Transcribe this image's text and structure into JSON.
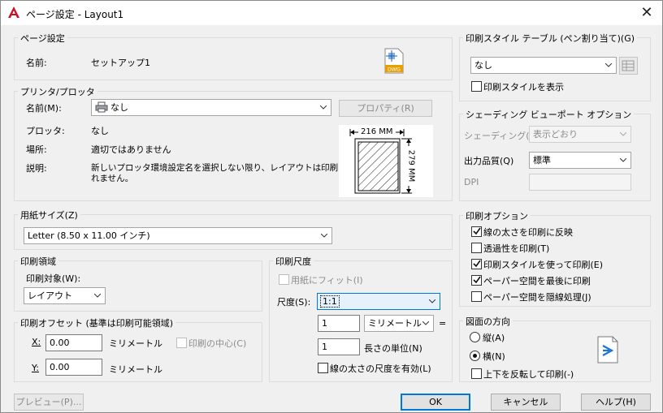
{
  "window": {
    "title": "ページ設定 - Layout1"
  },
  "page_setup": {
    "legend": "ページ設定",
    "name_label": "名前:",
    "name_value": "セットアップ1"
  },
  "printer": {
    "legend": "プリンタ/プロッタ",
    "name_label": "名前(M):",
    "name_value": "なし",
    "properties_button": "プロパティ(R)",
    "plotter_label": "プロッタ:",
    "plotter_value": "なし",
    "location_label": "場所:",
    "location_value": "適切ではありません",
    "description_label": "説明:",
    "description_line1": "新しいプロッタ環境設定名を選択しない限り、レイアウトは印刷さ",
    "description_line2": "れません。",
    "preview_width": "216 MM",
    "preview_height": "279 MM"
  },
  "paper_size": {
    "legend": "用紙サイズ(Z)",
    "value": "Letter (8.50 x 11.00 インチ)"
  },
  "plot_area": {
    "legend": "印刷領域",
    "what_label": "印刷対象(W):",
    "what_value": "レイアウト"
  },
  "plot_offset": {
    "legend": "印刷オフセット (基準は印刷可能領域)",
    "x_label": "X:",
    "x_value": "0.00",
    "x_unit": "ミリメートル",
    "y_label": "Y:",
    "y_value": "0.00",
    "y_unit": "ミリメートル",
    "center_label": "印刷の中心(C)"
  },
  "plot_scale": {
    "legend": "印刷尺度",
    "fit_label": "用紙にフィット(I)",
    "scale_label": "尺度(S):",
    "scale_value": "1:1",
    "value1": "1",
    "unit_value": "ミリメートル",
    "equals": "=",
    "value2": "1",
    "unit_label": "長さの単位(N)",
    "lineweights_label": "線の太さの尺度を有効(L)"
  },
  "plot_style_table": {
    "legend": "印刷スタイル テーブル (ペン割り当て)(G)",
    "value": "なし",
    "display_label": "印刷スタイルを表示"
  },
  "shaded_viewport": {
    "legend": "シェーディング ビューポート オプション",
    "shade_label": "シェーディング(D)",
    "shade_value": "表示どおり",
    "quality_label": "出力品質(Q)",
    "quality_value": "標準",
    "dpi_label": "DPI"
  },
  "plot_options": {
    "legend": "印刷オプション",
    "items": [
      {
        "label": "線の太さを印刷に反映",
        "checked": true
      },
      {
        "label": "透過性を印刷(T)",
        "checked": false
      },
      {
        "label": "印刷スタイルを使って印刷(E)",
        "checked": true
      },
      {
        "label": "ペーパー空間を最後に印刷",
        "checked": true
      },
      {
        "label": "ペーパー空間を隠線処理(J)",
        "checked": false
      }
    ]
  },
  "orientation": {
    "legend": "図面の方向",
    "portrait_label": "縦(A)",
    "landscape_label": "横(N)",
    "upside_down_label": "上下を反転して印刷(-)"
  },
  "footer": {
    "preview": "プレビュー(P)...",
    "ok": "OK",
    "cancel": "キャンセル",
    "help": "ヘルプ(H)"
  },
  "colors": {
    "accent": "#0078d7",
    "app_red": "#c8102e"
  }
}
